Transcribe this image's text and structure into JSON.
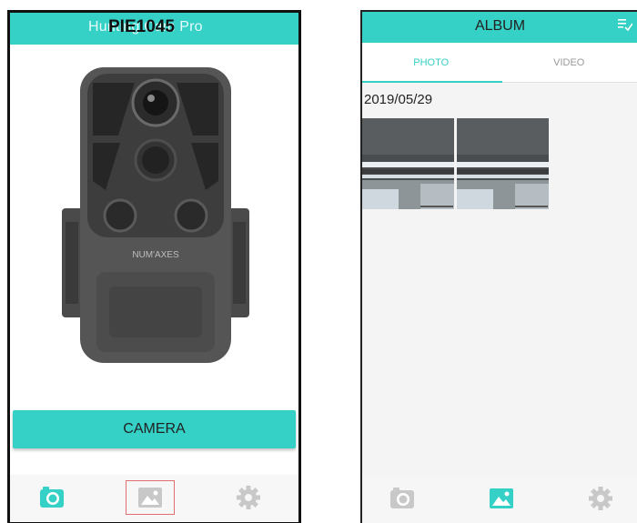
{
  "left_screen": {
    "title_underlay": "Hunting Cam Pro",
    "title_overlay": "PIE1045",
    "camera_brand": "NUM'AXES",
    "camera_button_label": "CAMERA",
    "active_tab": "camera",
    "highlighted_tab": "album"
  },
  "right_screen": {
    "title": "ALBUM",
    "tabs": [
      {
        "label": "PHOTO",
        "active": true
      },
      {
        "label": "VIDEO",
        "active": false
      }
    ],
    "date_group": "2019/05/29",
    "thumbnails_count": 2,
    "active_tab": "album"
  },
  "colors": {
    "accent": "#35d0c6",
    "icon_inactive": "#c8c8c8",
    "highlight_box": "#e07070"
  },
  "icons": [
    "camera-icon",
    "image-icon",
    "gear-icon",
    "select-list-icon"
  ]
}
